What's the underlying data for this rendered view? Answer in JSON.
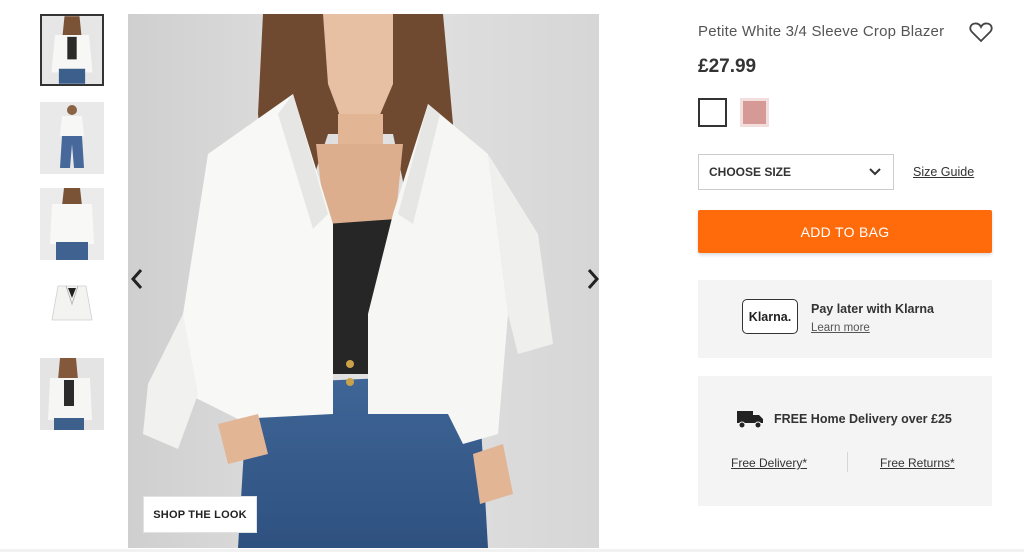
{
  "thumbnails": [
    {
      "label": "thumbnail-front-model"
    },
    {
      "label": "thumbnail-full-length"
    },
    {
      "label": "thumbnail-back-view"
    },
    {
      "label": "thumbnail-product-flat"
    },
    {
      "label": "thumbnail-model-side"
    }
  ],
  "product": {
    "title": "Petite White 3/4 Sleeve Crop Blazer",
    "price": "£27.99"
  },
  "swatches": [
    {
      "name": "white",
      "color": "#ffffff"
    },
    {
      "name": "pink",
      "color": "#d59a95"
    }
  ],
  "size": {
    "select_label": "CHOOSE SIZE",
    "guide_label": "Size Guide"
  },
  "cta": {
    "add_to_bag": "ADD TO BAG",
    "shop_the_look": "SHOP THE LOOK"
  },
  "klarna": {
    "badge": "Klarna.",
    "title": "Pay later with Klarna",
    "link": "Learn more"
  },
  "delivery": {
    "title": "FREE Home Delivery over £25",
    "free_delivery": "Free Delivery*",
    "free_returns": "Free Returns*"
  },
  "colors": {
    "accent": "#ff6b0b",
    "panel_bg": "#f4f4f4"
  },
  "icons": [
    "heart-icon",
    "chevron-left-icon",
    "chevron-right-icon",
    "chevron-down-icon",
    "truck-icon"
  ]
}
